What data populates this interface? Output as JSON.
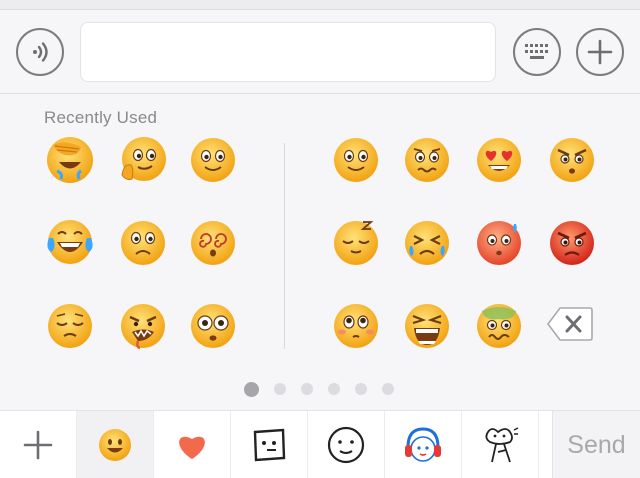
{
  "input_bar": {
    "voice_icon": "voice-wave-icon",
    "text_value": "",
    "keyboard_icon": "keyboard-icon",
    "plus_icon": "plus-icon"
  },
  "emoji_panel": {
    "section_label": "Recently Used",
    "recent": [
      "facepalm",
      "smirk-chin",
      "smile",
      "tears-of-joy",
      "worried",
      "dizzy",
      "pensive",
      "grimace-drool",
      "flushed"
    ],
    "page_emojis": [
      "smile",
      "awkward",
      "heart-eyes",
      "angry-brow",
      "sleepy",
      "crying-squint",
      "blush-scared",
      "rage",
      "puppy-eyes",
      "screaming",
      "nauseated"
    ],
    "delete_icon": "backspace-icon",
    "pages": 6,
    "current_page": 1
  },
  "tabbar": {
    "add_icon": "plus-icon",
    "tabs": [
      "emoji-face",
      "heart",
      "square-face",
      "outline-face",
      "headphone-character",
      "doodle-dog"
    ],
    "selected_tab": 0,
    "send_label": "Send"
  }
}
